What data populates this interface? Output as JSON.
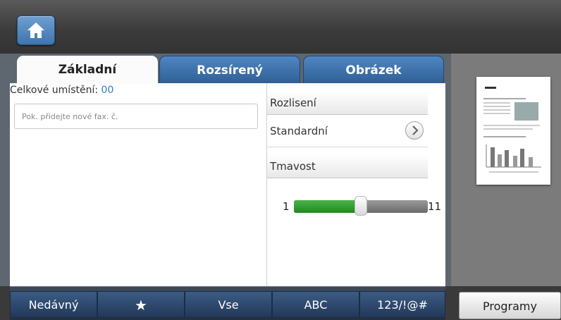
{
  "header": {
    "home_icon": "home-icon"
  },
  "tabs": [
    {
      "label": "Základní",
      "active": true
    },
    {
      "label": "Rozsírený",
      "active": false
    },
    {
      "label": "Obrázek",
      "active": false
    }
  ],
  "recipients": {
    "count_label": "Celkové umístění:",
    "count_value": "00",
    "input_placeholder": "Pok. přidejte nové fax. č."
  },
  "settings": {
    "resolution_header": "Rozlisení",
    "resolution_value": "Standardní",
    "resolution_icon": "chevron-right-circle-icon",
    "darkness_header": "Tmavost",
    "darkness_min": "1",
    "darkness_max": "11",
    "darkness_level": 6
  },
  "bottom_bar": [
    {
      "label": "Nedávný"
    },
    {
      "label": "★",
      "icon": "star-icon"
    },
    {
      "label": "Vse"
    },
    {
      "label": "ABC"
    },
    {
      "label": "123/!@#"
    }
  ],
  "programs_label": "Programy",
  "colors": {
    "tab_blue": "#4f86c2",
    "slider_green": "#2b9a2b",
    "count_blue": "#2f7fc5"
  }
}
